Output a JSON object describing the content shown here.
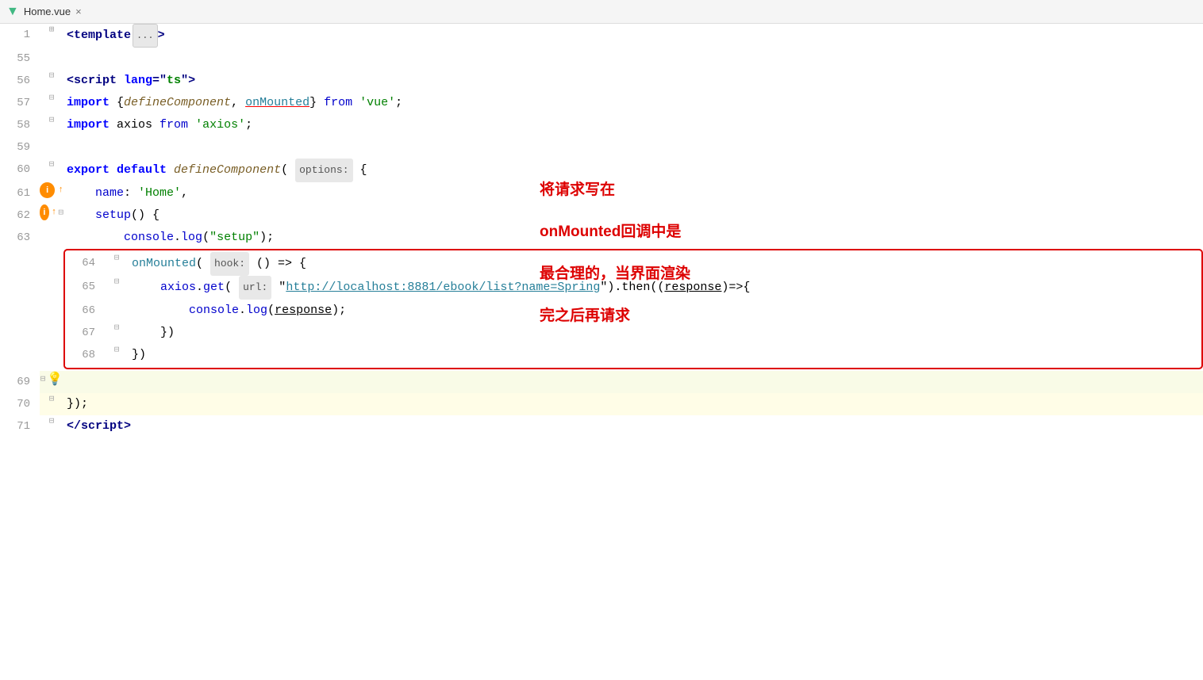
{
  "tab": {
    "icon": "▼",
    "label": "Home.vue",
    "close": "×"
  },
  "lines": [
    {
      "number": "1",
      "gutter": "fold",
      "content_type": "template_fold",
      "bg": ""
    },
    {
      "number": "55",
      "gutter": "",
      "content_type": "empty",
      "bg": ""
    },
    {
      "number": "56",
      "gutter": "fold",
      "content_type": "script_tag",
      "bg": ""
    },
    {
      "number": "57",
      "gutter": "fold",
      "content_type": "import_vue",
      "bg": ""
    },
    {
      "number": "58",
      "gutter": "fold",
      "content_type": "import_axios",
      "bg": ""
    },
    {
      "number": "59",
      "gutter": "",
      "content_type": "empty",
      "bg": ""
    },
    {
      "number": "60",
      "gutter": "fold",
      "content_type": "export_default",
      "bg": ""
    },
    {
      "number": "61",
      "gutter": "badge_i",
      "content_type": "name",
      "bg": ""
    },
    {
      "number": "62",
      "gutter": "badge_i_fold",
      "content_type": "setup",
      "bg": ""
    },
    {
      "number": "63",
      "gutter": "",
      "content_type": "console_setup",
      "bg": ""
    },
    {
      "number": "64",
      "gutter": "fold",
      "content_type": "on_mounted_open",
      "bg": "",
      "in_box": true
    },
    {
      "number": "65",
      "gutter": "fold",
      "content_type": "axios_get",
      "bg": "",
      "in_box": true
    },
    {
      "number": "66",
      "gutter": "",
      "content_type": "console_response",
      "bg": "",
      "in_box": true
    },
    {
      "number": "67",
      "gutter": "fold",
      "content_type": "close_paren_1",
      "bg": "",
      "in_box": true
    },
    {
      "number": "68",
      "gutter": "fold",
      "content_type": "close_paren_2",
      "bg": "",
      "in_box": true
    },
    {
      "number": "69",
      "gutter": "fold",
      "content_type": "bulb",
      "bg": "light"
    },
    {
      "number": "70",
      "gutter": "fold",
      "content_type": "close_brace",
      "bg": "yellow"
    },
    {
      "number": "71",
      "gutter": "fold",
      "content_type": "script_close",
      "bg": ""
    }
  ],
  "annotation": {
    "line1": "将请求写在",
    "line2": "onMounted回调中是",
    "line3": "最合理的，当界面渲染",
    "line4": "完之后再请求"
  },
  "colors": {
    "red_border": "#dd0000",
    "accent": "#41b883"
  }
}
